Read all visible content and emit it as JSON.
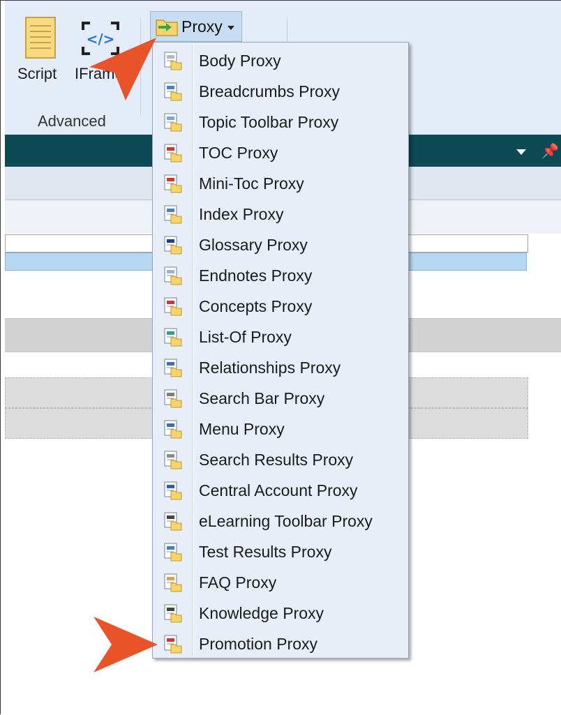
{
  "ribbon": {
    "script_label": "Script",
    "iframe_label": "IFrame",
    "group_label": "Advanced",
    "proxy_button_label": "Proxy"
  },
  "menu": {
    "items": [
      {
        "label": "Body Proxy",
        "icon": "body-proxy-icon",
        "accent": "#b8b8b8"
      },
      {
        "label": "Breadcrumbs Proxy",
        "icon": "breadcrumbs-proxy-icon",
        "accent": "#4a7fc0"
      },
      {
        "label": "Topic Toolbar Proxy",
        "icon": "topic-toolbar-proxy-icon",
        "accent": "#7aa7d8"
      },
      {
        "label": "TOC Proxy",
        "icon": "toc-proxy-icon",
        "accent": "#d9342b"
      },
      {
        "label": "Mini-Toc Proxy",
        "icon": "mini-toc-proxy-icon",
        "accent": "#e0302a"
      },
      {
        "label": "Index Proxy",
        "icon": "index-proxy-icon",
        "accent": "#4a7fc0"
      },
      {
        "label": "Glossary Proxy",
        "icon": "glossary-proxy-icon",
        "accent": "#1c3f8a"
      },
      {
        "label": "Endnotes Proxy",
        "icon": "endnotes-proxy-icon",
        "accent": "#9ab5d4"
      },
      {
        "label": "Concepts Proxy",
        "icon": "concepts-proxy-icon",
        "accent": "#c9363b"
      },
      {
        "label": "List-Of Proxy",
        "icon": "list-of-proxy-icon",
        "accent": "#2aa38a"
      },
      {
        "label": "Relationships Proxy",
        "icon": "relationships-proxy-icon",
        "accent": "#3c6fb5"
      },
      {
        "label": "Search Bar Proxy",
        "icon": "search-bar-proxy-icon",
        "accent": "#7d7d7d"
      },
      {
        "label": "Menu Proxy",
        "icon": "menu-proxy-icon",
        "accent": "#3d6eb3"
      },
      {
        "label": "Search Results Proxy",
        "icon": "search-results-proxy-icon",
        "accent": "#8a8a8a"
      },
      {
        "label": "Central Account Proxy",
        "icon": "central-account-proxy-icon",
        "accent": "#2d5fab"
      },
      {
        "label": "eLearning Toolbar Proxy",
        "icon": "elearning-toolbar-proxy-icon",
        "accent": "#444444"
      },
      {
        "label": "Test Results Proxy",
        "icon": "test-results-proxy-icon",
        "accent": "#3b82c4"
      },
      {
        "label": "FAQ Proxy",
        "icon": "faq-proxy-icon",
        "accent": "#d9a441"
      },
      {
        "label": "Knowledge Proxy",
        "icon": "knowledge-proxy-icon",
        "accent": "#444444"
      },
      {
        "label": "Promotion Proxy",
        "icon": "promotion-proxy-icon",
        "accent": "#d9342b"
      }
    ]
  },
  "colors": {
    "ribbon_bg": "#e4ecf7",
    "menu_bg": "#e7eef7",
    "teal_bar": "#0c4a55",
    "callout_arrow": "#e8532a",
    "proxy_folder": "#f5d56b"
  }
}
